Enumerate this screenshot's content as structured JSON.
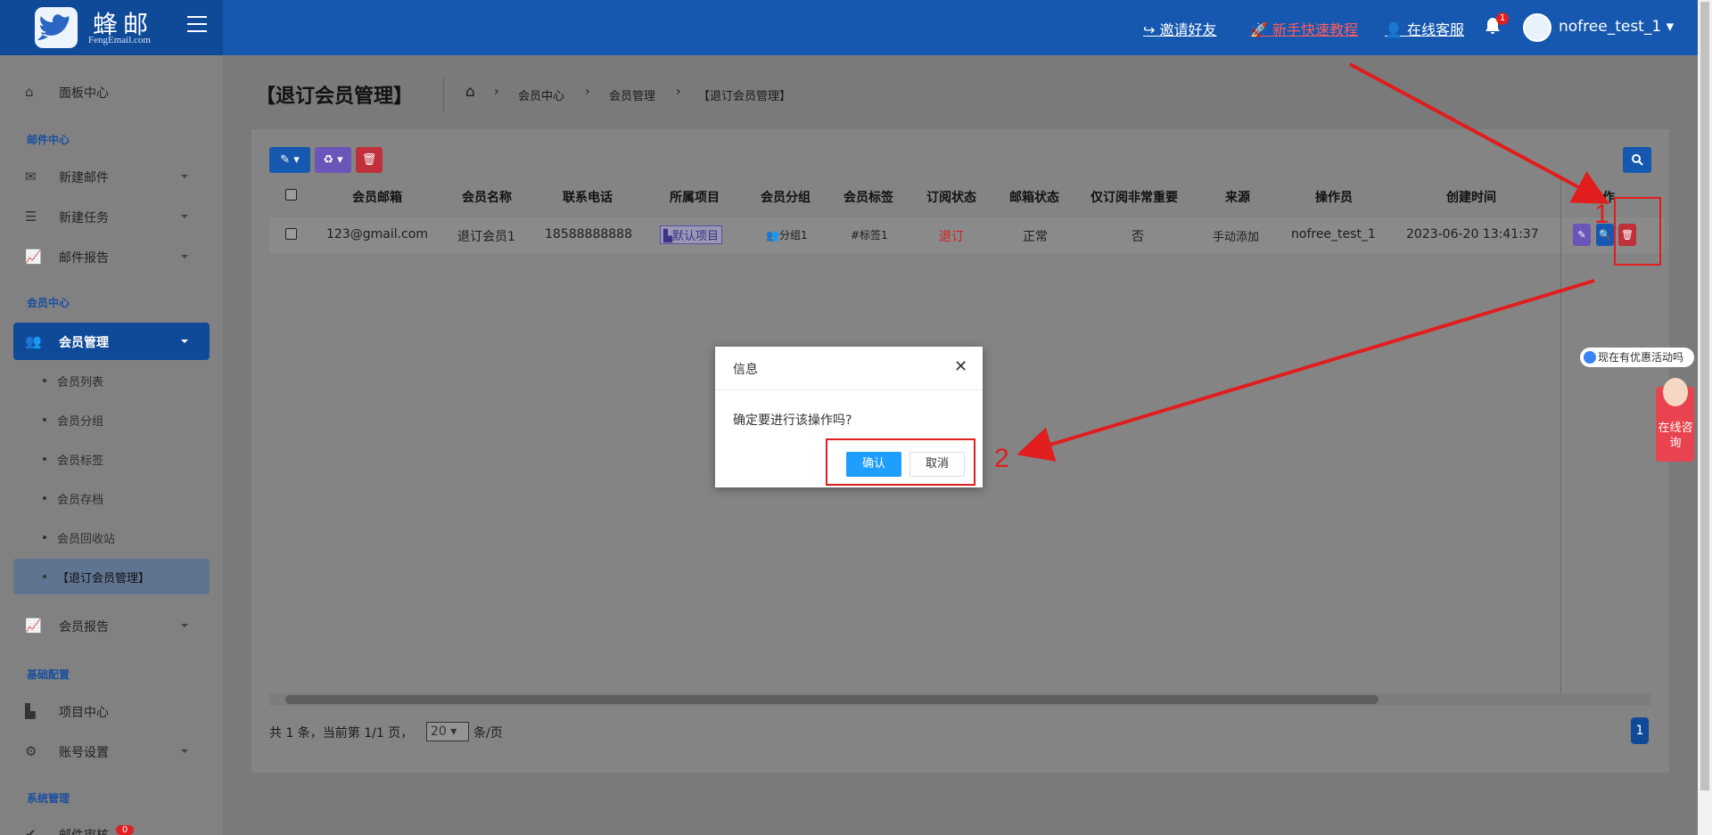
{
  "header": {
    "brand": "蜂邮",
    "brand_sub": "FengEmail.com",
    "links": [
      "邀请好友",
      "新手快速教程",
      "在线客服"
    ],
    "notification_count": "1",
    "user": "nofree_test_1"
  },
  "sidebar": {
    "dashboard": "面板中心",
    "section_mail": "邮件中心",
    "new_mail": "新建邮件",
    "new_task": "新建任务",
    "mail_report": "邮件报告",
    "section_member": "会员中心",
    "member_mgmt": "会员管理",
    "sub_items": [
      "会员列表",
      "会员分组",
      "会员标签",
      "会员存档",
      "会员回收站",
      "【退订会员管理】"
    ],
    "member_report": "会员报告",
    "section_config": "基础配置",
    "project_center": "项目中心",
    "account_settings": "账号设置",
    "section_system": "系统管理",
    "mail_audit": "邮件审核",
    "mail_audit_badge": "0"
  },
  "page": {
    "title": "【退订会员管理】",
    "breadcrumb": [
      "会员中心",
      "会员管理",
      "【退订会员管理】"
    ]
  },
  "table": {
    "headers": [
      "会员邮箱",
      "会员名称",
      "联系电话",
      "所属项目",
      "会员分组",
      "会员标签",
      "订阅状态",
      "邮箱状态",
      "仅订阅非常重要",
      "来源",
      "操作员",
      "创建时间",
      "操作"
    ],
    "row": {
      "email": "123@gmail.com",
      "name": "退订会员1",
      "phone": "18588888888",
      "project": "默认项目",
      "group": "分组1",
      "tag": "#标签1",
      "sub_status": "退订",
      "mail_status": "正常",
      "important_only": "否",
      "source": "手动添加",
      "operator": "nofree_test_1",
      "created": "2023-06-20 13:41:37"
    }
  },
  "pager": {
    "summary": "共 1 条，当前第 1/1 页，",
    "page_size": "20",
    "unit": "条/页",
    "current_page": "1"
  },
  "modal": {
    "title": "信息",
    "message": "确定要进行该操作吗?",
    "confirm": "确认",
    "cancel": "取消"
  },
  "annotations": {
    "one": "1",
    "two": "2"
  },
  "widget": {
    "bubble": "现在有优惠活动吗",
    "online": "在线咨询"
  },
  "colors": {
    "primary": "#1657b0",
    "danger": "#e11d1d",
    "edit_btn": "#6a55b8",
    "confirm_btn": "#1e9fff"
  }
}
